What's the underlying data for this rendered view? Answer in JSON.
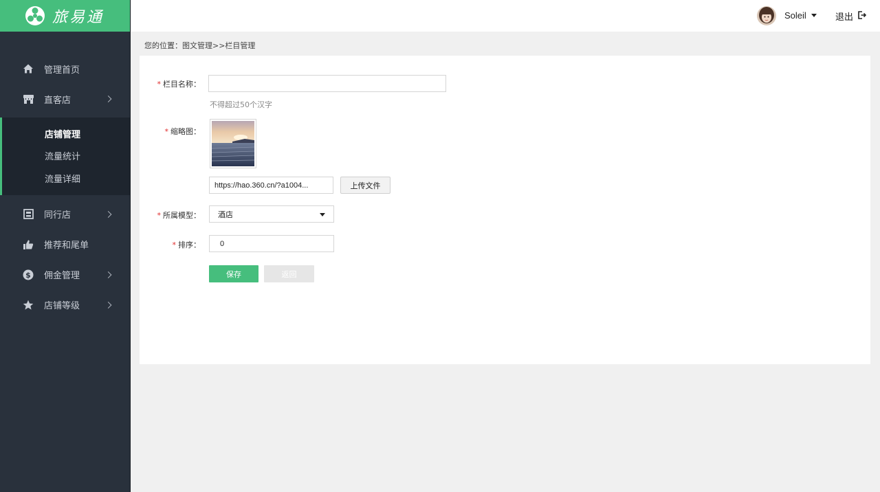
{
  "brand": {
    "name": "旅易通",
    "color": "#46be7d"
  },
  "header": {
    "username": "Soleil",
    "logout_label": "退出"
  },
  "sidebar": {
    "items": [
      {
        "label": "管理首页",
        "icon": "home-icon"
      },
      {
        "label": "直客店",
        "icon": "store-icon",
        "has_arrow": true
      },
      {
        "label": "同行店",
        "icon": "shop-icon",
        "has_arrow": true
      },
      {
        "label": "推荐和尾单",
        "icon": "thumbs-up-icon"
      },
      {
        "label": "佣金管理",
        "icon": "dollar-icon",
        "has_arrow": true
      },
      {
        "label": "店铺等级",
        "icon": "star-icon",
        "has_arrow": true
      }
    ],
    "submenu": [
      {
        "label": "店铺管理",
        "active": true
      },
      {
        "label": "流量统计"
      },
      {
        "label": "流量详细"
      }
    ]
  },
  "breadcrumb": {
    "prefix": "您的位置：",
    "path": "图文管理>>栏目管理"
  },
  "form": {
    "name_label": "栏目名称：",
    "name_value": "",
    "name_hint": "不得超过50个汉字",
    "thumb_label": "缩略图：",
    "thumb_url": "https://hao.360.cn/?a1004...",
    "upload_label": "上传文件",
    "model_label": "所属模型：",
    "model_value": "酒店",
    "sort_label": "排序：",
    "sort_value": "0",
    "save_label": "保存",
    "back_label": "返回",
    "required_mark": "*"
  }
}
